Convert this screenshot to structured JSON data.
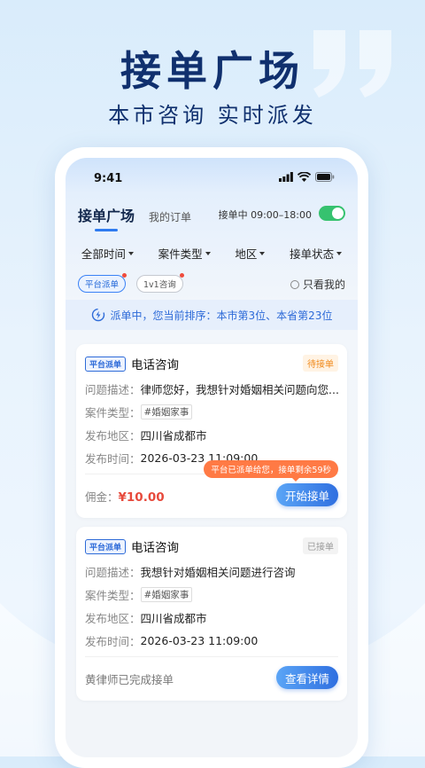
{
  "hero": {
    "title": "接单广场",
    "subtitle": "本市咨询 实时派发"
  },
  "status_bar": {
    "time": "9:41",
    "icons": [
      "signal-icon",
      "wifi-icon",
      "battery-icon"
    ]
  },
  "tabs": {
    "active": "接单广场",
    "inactive": "我的订单"
  },
  "shift": {
    "label": "接单中 09:00–18:00",
    "toggle_on": true
  },
  "filters": [
    {
      "label": "全部时间"
    },
    {
      "label": "案件类型"
    },
    {
      "label": "地区"
    },
    {
      "label": "接单状态"
    }
  ],
  "chips": [
    {
      "label": "平台派单",
      "active": true
    },
    {
      "label": "1v1咨询",
      "active": false
    }
  ],
  "only_mine_label": "只看我的",
  "banner_text": "派单中，您当前排序：本市第3位、本省第23位",
  "field_labels": {
    "desc": "问题描述：",
    "case_type": "案件类型：",
    "region": "发布地区：",
    "time": "发布时间："
  },
  "cards": [
    {
      "badge": "平台派单",
      "title": "电话咨询",
      "status": "待接单",
      "desc": "律师您好，我想针对婚姻相关问题向您...",
      "case_type": "#婚姻家事",
      "region": "四川省成都市",
      "time": "2026-03-23 11:09:00",
      "tooltip": "平台已派单给您，接单剩余59秒",
      "fee_label": "佣金：",
      "fee_amount": "¥10.00",
      "button": "开始接单"
    },
    {
      "badge": "平台派单",
      "title": "电话咨询",
      "status": "已接单",
      "desc": "我想针对婚姻相关问题进行咨询",
      "case_type": "#婚姻家事",
      "region": "四川省成都市",
      "time": "2026-03-23 11:09:00",
      "footer": "黄律师已完成接单",
      "button": "查看详情"
    }
  ],
  "colors": {
    "primary": "#2e6bd8",
    "accent_orange": "#f08a1c",
    "price_red": "#e74a3c",
    "toggle_green": "#36c26f",
    "hero_title": "#10306e"
  }
}
